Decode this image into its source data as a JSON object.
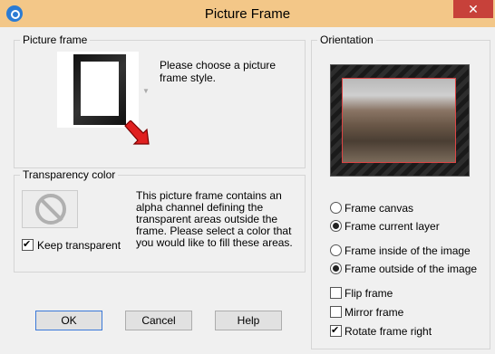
{
  "window": {
    "title": "Picture Frame",
    "close_glyph": "✕"
  },
  "picture_frame": {
    "legend": "Picture frame",
    "description": "Please choose a picture frame style."
  },
  "transparency": {
    "legend": "Transparency color",
    "description": "This picture frame contains an alpha channel defining the transparent areas outside the frame.  Please select a color that you would like to fill these areas.",
    "keep_transparent_label": "Keep transparent",
    "keep_transparent_checked": true
  },
  "orientation": {
    "legend": "Orientation",
    "radios_group1": [
      {
        "label": "Frame canvas",
        "checked": false
      },
      {
        "label": "Frame current layer",
        "checked": true
      }
    ],
    "radios_group2": [
      {
        "label": "Frame inside of the image",
        "checked": false
      },
      {
        "label": "Frame outside of the image",
        "checked": true
      }
    ],
    "checkboxes": [
      {
        "label": "Flip frame",
        "checked": false
      },
      {
        "label": "Mirror frame",
        "checked": false
      },
      {
        "label": "Rotate frame right",
        "checked": true
      }
    ]
  },
  "buttons": {
    "ok": "OK",
    "cancel": "Cancel",
    "help": "Help"
  },
  "colors": {
    "titlebar": "#f3c788",
    "close": "#c7413a",
    "arrow": "#e02020"
  }
}
